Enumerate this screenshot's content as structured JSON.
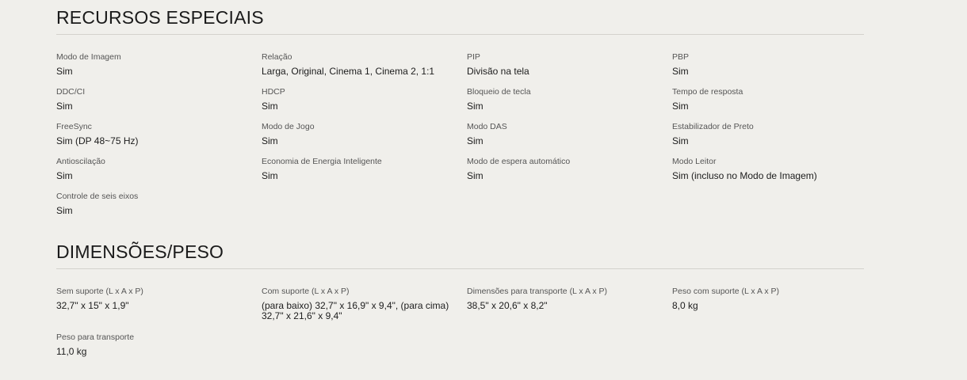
{
  "recursos": {
    "title": "RECURSOS ESPECIAIS",
    "items": [
      {
        "label": "Modo de Imagem",
        "value": "Sim"
      },
      {
        "label": "Relação",
        "value": "Larga, Original, Cinema 1, Cinema 2, 1:1"
      },
      {
        "label": "PIP",
        "value": "Divisão na tela"
      },
      {
        "label": "PBP",
        "value": "Sim"
      },
      {
        "label": "DDC/CI",
        "value": "Sim"
      },
      {
        "label": "HDCP",
        "value": "Sim"
      },
      {
        "label": "Bloqueio de tecla",
        "value": "Sim"
      },
      {
        "label": "Tempo de resposta",
        "value": "Sim"
      },
      {
        "label": "FreeSync",
        "value": "Sim (DP 48~75 Hz)"
      },
      {
        "label": "Modo de Jogo",
        "value": "Sim"
      },
      {
        "label": "Modo DAS",
        "value": "Sim"
      },
      {
        "label": "Estabilizador de Preto",
        "value": "Sim"
      },
      {
        "label": "Antioscilação",
        "value": "Sim"
      },
      {
        "label": "Economia de Energia Inteligente",
        "value": "Sim"
      },
      {
        "label": "Modo de espera automático",
        "value": "Sim"
      },
      {
        "label": "Modo Leitor",
        "value": "Sim (incluso no Modo de Imagem)"
      },
      {
        "label": "Controle de seis eixos",
        "value": "Sim"
      }
    ]
  },
  "dimensoes": {
    "title": "DIMENSÕES/PESO",
    "items": [
      {
        "label": "Sem suporte (L x A x P)",
        "value": "32,7\" x 15\" x 1,9\""
      },
      {
        "label": "Com suporte (L x A x P)",
        "value": "(para baixo) 32,7\" x 16,9\" x 9,4\", (para cima) 32,7\" x 21,6\" x 9,4\""
      },
      {
        "label": "Dimensões para transporte (L x A x P)",
        "value": "38,5\" x 20,6\" x 8,2\""
      },
      {
        "label": "Peso com suporte (L x A x P)",
        "value": "8,0 kg"
      },
      {
        "label": "Peso para transporte",
        "value": "11,0 kg"
      }
    ]
  }
}
